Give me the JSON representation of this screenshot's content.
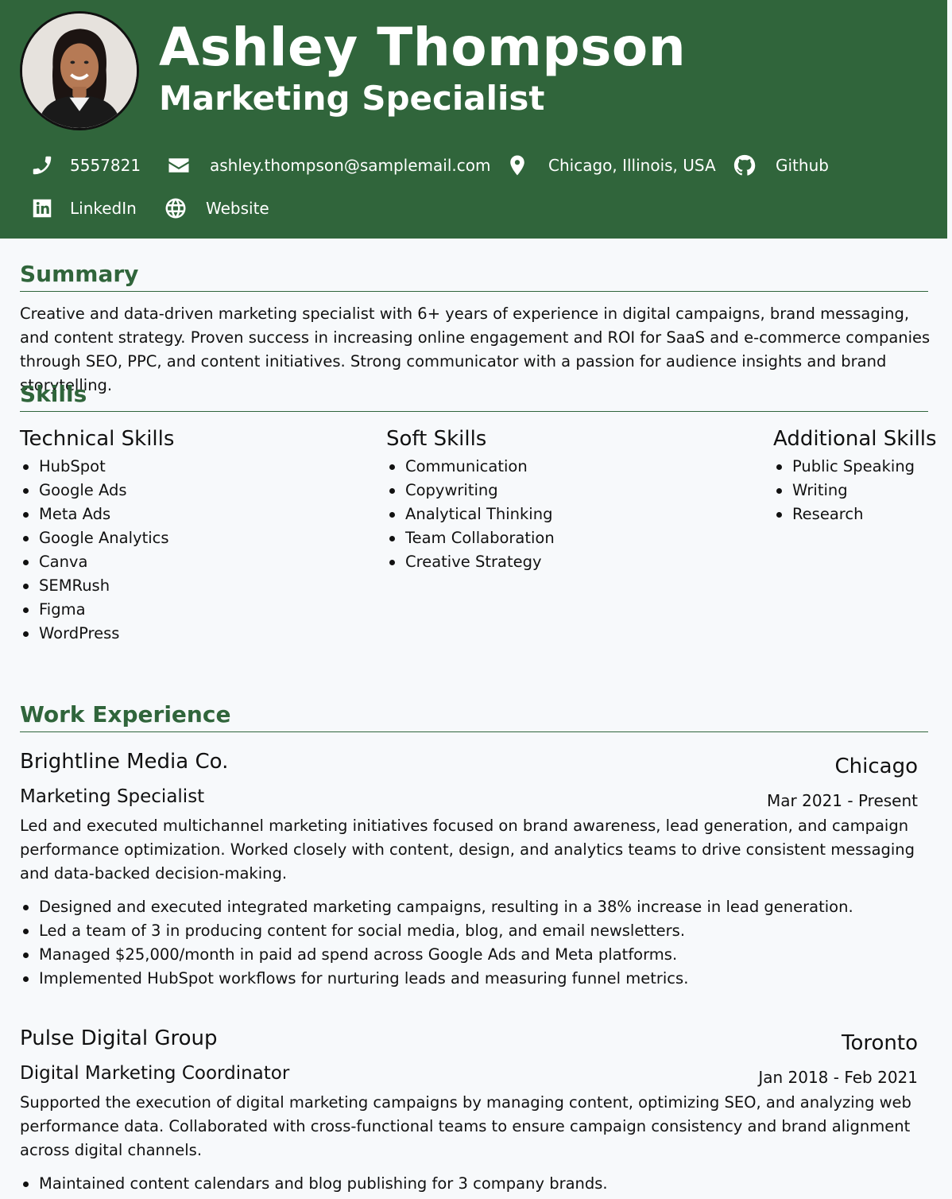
{
  "header": {
    "name": "Ashley Thompson",
    "title": "Marketing Specialist",
    "contacts": [
      {
        "icon": "phone-icon",
        "label": "5557821"
      },
      {
        "icon": "email-icon",
        "label": "ashley.thompson@samplemail.com"
      },
      {
        "icon": "location-pin-icon",
        "label": "Chicago, Illinois, USA"
      },
      {
        "icon": "github-icon",
        "label": "Github"
      },
      {
        "icon": "linkedin-icon",
        "label": "LinkedIn"
      },
      {
        "icon": "globe-icon",
        "label": "Website"
      }
    ]
  },
  "colors": {
    "accent": "#30653b",
    "background": "#f7f9fb"
  },
  "summary": {
    "heading": "Summary",
    "text": "Creative and data-driven marketing specialist with 6+ years of experience in digital campaigns, brand messaging, and content strategy. Proven success in increasing online engagement and ROI for SaaS and e-commerce companies through SEO, PPC, and content initiatives. Strong communicator with a passion for audience insights and brand storytelling."
  },
  "skills": {
    "heading": "Skills",
    "groups": [
      {
        "title": "Technical Skills",
        "items": [
          "HubSpot",
          "Google Ads",
          "Meta Ads",
          "Google Analytics",
          "Canva",
          "SEMRush",
          "Figma",
          "WordPress"
        ]
      },
      {
        "title": "Soft Skills",
        "items": [
          "Communication",
          "Copywriting",
          "Analytical Thinking",
          "Team Collaboration",
          "Creative Strategy"
        ]
      },
      {
        "title": "Additional Skills",
        "items": [
          "Public Speaking",
          "Writing",
          "Research"
        ]
      }
    ]
  },
  "experience": {
    "heading": "Work Experience",
    "jobs": [
      {
        "company": "Brightline Media Co.",
        "city": "Chicago",
        "role": "Marketing Specialist",
        "dates": "Mar 2021 - Present",
        "description": "Led and executed multichannel marketing initiatives focused on brand awareness, lead generation, and campaign performance optimization. Worked closely with content, design, and analytics teams to drive consistent messaging and data-backed decision-making.",
        "bullets": [
          "Designed and executed integrated marketing campaigns, resulting in a 38% increase in lead generation.",
          "Led a team of 3 in producing content for social media, blog, and email newsletters.",
          "Managed $25,000/month in paid ad spend across Google Ads and Meta platforms.",
          "Implemented HubSpot workflows for nurturing leads and measuring funnel metrics."
        ]
      },
      {
        "company": "Pulse Digital Group",
        "city": "Toronto",
        "role": "Digital Marketing Coordinator",
        "dates": "Jan 2018 - Feb 2021",
        "description": "Supported the execution of digital marketing campaigns by managing content, optimizing SEO, and analyzing web performance data. Collaborated with cross-functional teams to ensure campaign consistency and brand alignment across digital channels.",
        "bullets": [
          "Maintained content calendars and blog publishing for 3 company brands."
        ]
      }
    ]
  }
}
